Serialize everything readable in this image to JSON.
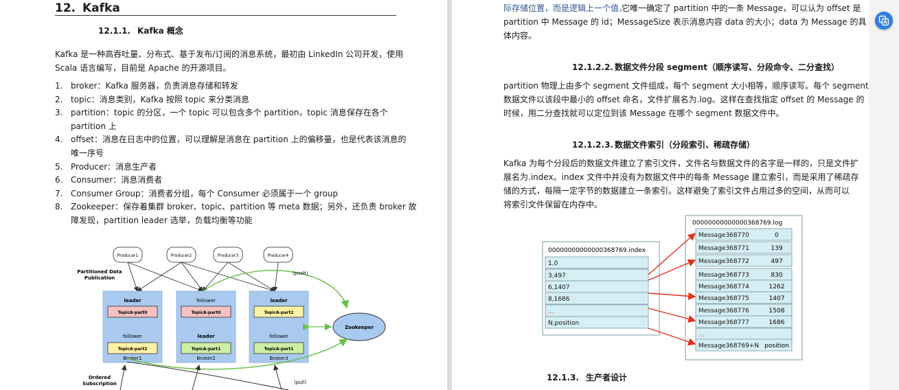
{
  "left": {
    "h1_num": "12.",
    "h1_title": "Kafka",
    "s1_num": "12.1.1.",
    "s1_title": "Kafka 概念",
    "intro_l1": "Kafka 是一种高吞吐量、分布式、基于发布/订阅的消息系统，最初由 LinkedIn 公司开发，使用",
    "intro_l2": "Scala 语言编写，目前是 Apache 的开源项目。",
    "items": [
      {
        "n": "1.",
        "lines": [
          "broker：Kafka 服务器，负责消息存储和转发"
        ]
      },
      {
        "n": "2.",
        "lines": [
          "topic：消息类别，Kafka 按照 topic 来分类消息"
        ]
      },
      {
        "n": "3.",
        "lines": [
          "partition：topic 的分区，一个 topic 可以包含多个 partition，topic 消息保存在各个",
          "partition 上"
        ]
      },
      {
        "n": "4.",
        "lines": [
          "offset：消息在日志中的位置，可以理解是消息在 partition 上的偏移量，也是代表该消息的",
          "唯一序号"
        ]
      },
      {
        "n": "5.",
        "lines": [
          "Producer：消息生产者"
        ]
      },
      {
        "n": "6.",
        "lines": [
          "Consumer：消息消费者"
        ]
      },
      {
        "n": "7.",
        "lines": [
          "Consumer Group：消费者分组，每个 Consumer 必须属于一个 group"
        ]
      },
      {
        "n": "8.",
        "lines": [
          "Zookeeper：保存着集群 broker、topic、partition 等 meta 数据；另外，还负责 broker 故",
          "障发现，partition leader 选举，负载均衡等功能"
        ]
      }
    ],
    "diagram": {
      "producers": [
        "Producer1",
        "Producer2",
        "Producer3",
        "Producer4"
      ],
      "partitioned_label_1": "Partitioned Data",
      "partitioned_label_2": "Publication",
      "push_label": "(push)",
      "pull_label": "(pull)",
      "ordered_label_1": "Ordered",
      "ordered_label_2": "Subscription",
      "zookeeper": "Zookeeper",
      "brokers": [
        {
          "name": "Broker1",
          "top_role": "leader",
          "top_part": "TopicA-part0",
          "bottom_role": "follower",
          "bottom_part": "TopicA-part2"
        },
        {
          "name": "Broker2",
          "top_role": "follower",
          "top_part": "TopicA-part0",
          "bottom_role": "leader",
          "bottom_part": "TopicA-part1"
        },
        {
          "name": "Broker3",
          "top_role": "leader",
          "top_part": "TopicA-part2",
          "bottom_role": "follower",
          "bottom_part": "TopicA-part1"
        }
      ]
    }
  },
  "right": {
    "cont_l1_blue": "际存储位置，而是逻辑上一个值，",
    "cont_l1_rest": "它唯一确定了 partition 中的一条 Message，可以认为 offset 是",
    "cont_l2": "partition 中 Message 的 id；MessageSize 表示消息内容 data 的大小；data 为 Message 的具",
    "cont_l3": "体内容。",
    "s122_num": "12.1.2.2.",
    "s122_title": "数据文件分段 segment（顺序读写、分段命令、二分查找）",
    "p122_l1": "partition 物理上由多个 segment 文件组成，每个 segment 大小相等，顺序读写。每个 segment",
    "p122_l2": "数据文件以该段中最小的 offset 命名，文件扩展名为.log。这样在查找指定 offset 的 Message 的",
    "p122_l3": "时候，用二分查找就可以定位到该 Message 在哪个 segment 数据文件中。",
    "s123_num": "12.1.2.3.",
    "s123_title": "数据文件索引（分段索引、稀疏存储）",
    "p123_l1": "Kafka 为每个分段后的数据文件建立了索引文件，文件名与数据文件的名字是一样的，只是文件扩",
    "p123_l2": "展名为.index。index 文件中并没有为数据文件中的每条 Message 建立索引，而是采用了稀疏存",
    "p123_l3": "储的方式，每隔一定字节的数据建立一条索引。这样避免了索引文件占用过多的空间，从而可以",
    "p123_l4": "将索引文件保留在内存中。",
    "index_file": {
      "title": "00000000000000368769.index",
      "rows": [
        "1,0",
        "3,497",
        "6,1407",
        "8,1686",
        "...",
        "N,position"
      ]
    },
    "log_file": {
      "title": "00000000000000368769.log",
      "rows": [
        [
          "Message368770",
          "0"
        ],
        [
          "Message368771",
          "139"
        ],
        [
          "Message368772",
          "497"
        ],
        [
          "Message368773",
          "830"
        ],
        [
          "Message368774",
          "1262"
        ],
        [
          "Message368775",
          "1407"
        ],
        [
          "Message368776",
          "1508"
        ],
        [
          "Message368777",
          "1686"
        ],
        [
          "...",
          ""
        ],
        [
          "Message368769+N",
          "position"
        ]
      ]
    },
    "s13_num": "12.1.3.",
    "s13_title": "生产者设计"
  },
  "colors": {
    "accent_blue": "#2f5597",
    "broker_fill": "#a9c9ee",
    "part_red": "#f6c1c1",
    "part_yellow": "#fff2a6",
    "part_green": "#cdeea3",
    "arrow_red": "#e0301e",
    "push_green": "#6cc04a",
    "cell_fill": "#d5eef3",
    "zookeeper_fill": "#a9c9ee"
  },
  "icons": [
    "translate-icon"
  ]
}
